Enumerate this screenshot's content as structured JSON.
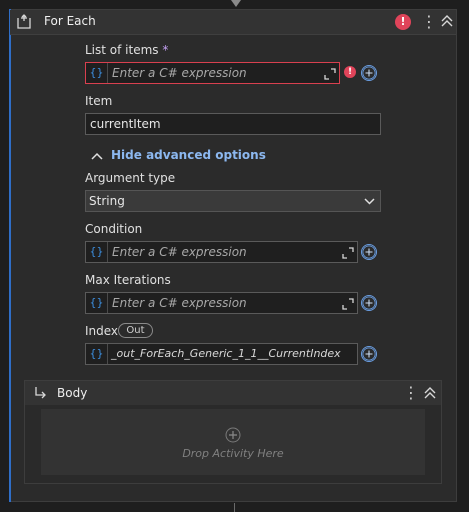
{
  "activity": {
    "title": "For Each",
    "error_mark": "!"
  },
  "fields": {
    "list_of_items": {
      "label": "List of items",
      "required_mark": "*",
      "placeholder": "Enter a C# expression",
      "prefix": "{}"
    },
    "item": {
      "label": "Item",
      "value": "currentItem"
    },
    "advanced_toggle": "Hide advanced options",
    "argument_type": {
      "label": "Argument type",
      "value": "String"
    },
    "condition": {
      "label": "Condition",
      "placeholder": "Enter a C# expression",
      "prefix": "{}"
    },
    "max_iterations": {
      "label": "Max Iterations",
      "placeholder": "Enter a C# expression",
      "prefix": "{}"
    },
    "index": {
      "label": "Index",
      "direction": "Out",
      "value": "_out_ForEach_Generic_1_1__CurrentIndex",
      "prefix": "{}"
    }
  },
  "body": {
    "title": "Body",
    "drop_text": "Drop Activity Here"
  },
  "colors": {
    "accent": "#2f6ec7",
    "error": "#e0445a",
    "link": "#8cb8f0"
  }
}
